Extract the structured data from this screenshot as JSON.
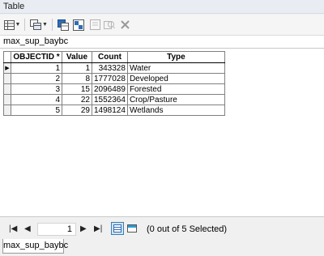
{
  "window": {
    "title": "Table"
  },
  "toolbar": {
    "icons": [
      "table-options-icon",
      "related-tables-icon",
      "select-by-attributes-icon",
      "switch-selection-icon",
      "clear-selection-icon",
      "zoom-to-selected-icon",
      "delete-selected-icon"
    ]
  },
  "table_tab": {
    "name": "max_sup_baybc"
  },
  "grid": {
    "columns": [
      "OBJECTID *",
      "Value",
      "Count",
      "Type"
    ],
    "rows": [
      {
        "objectid": "1",
        "value": "1",
        "count": "343328",
        "type": "Water"
      },
      {
        "objectid": "2",
        "value": "8",
        "count": "1777028",
        "type": "Developed"
      },
      {
        "objectid": "3",
        "value": "15",
        "count": "2096489",
        "type": "Forested"
      },
      {
        "objectid": "4",
        "value": "22",
        "count": "1552364",
        "type": "Crop/Pasture"
      },
      {
        "objectid": "5",
        "value": "29",
        "count": "1498124",
        "type": "Wetlands"
      }
    ],
    "current_row": 0
  },
  "navigation": {
    "first": "|◀",
    "prev": "◀",
    "current_record": "1",
    "next": "▶",
    "last": "▶|"
  },
  "status": {
    "selection_text": "(0 out of 5 Selected)"
  },
  "bottom_tab": {
    "name": "max_sup_baybc"
  }
}
